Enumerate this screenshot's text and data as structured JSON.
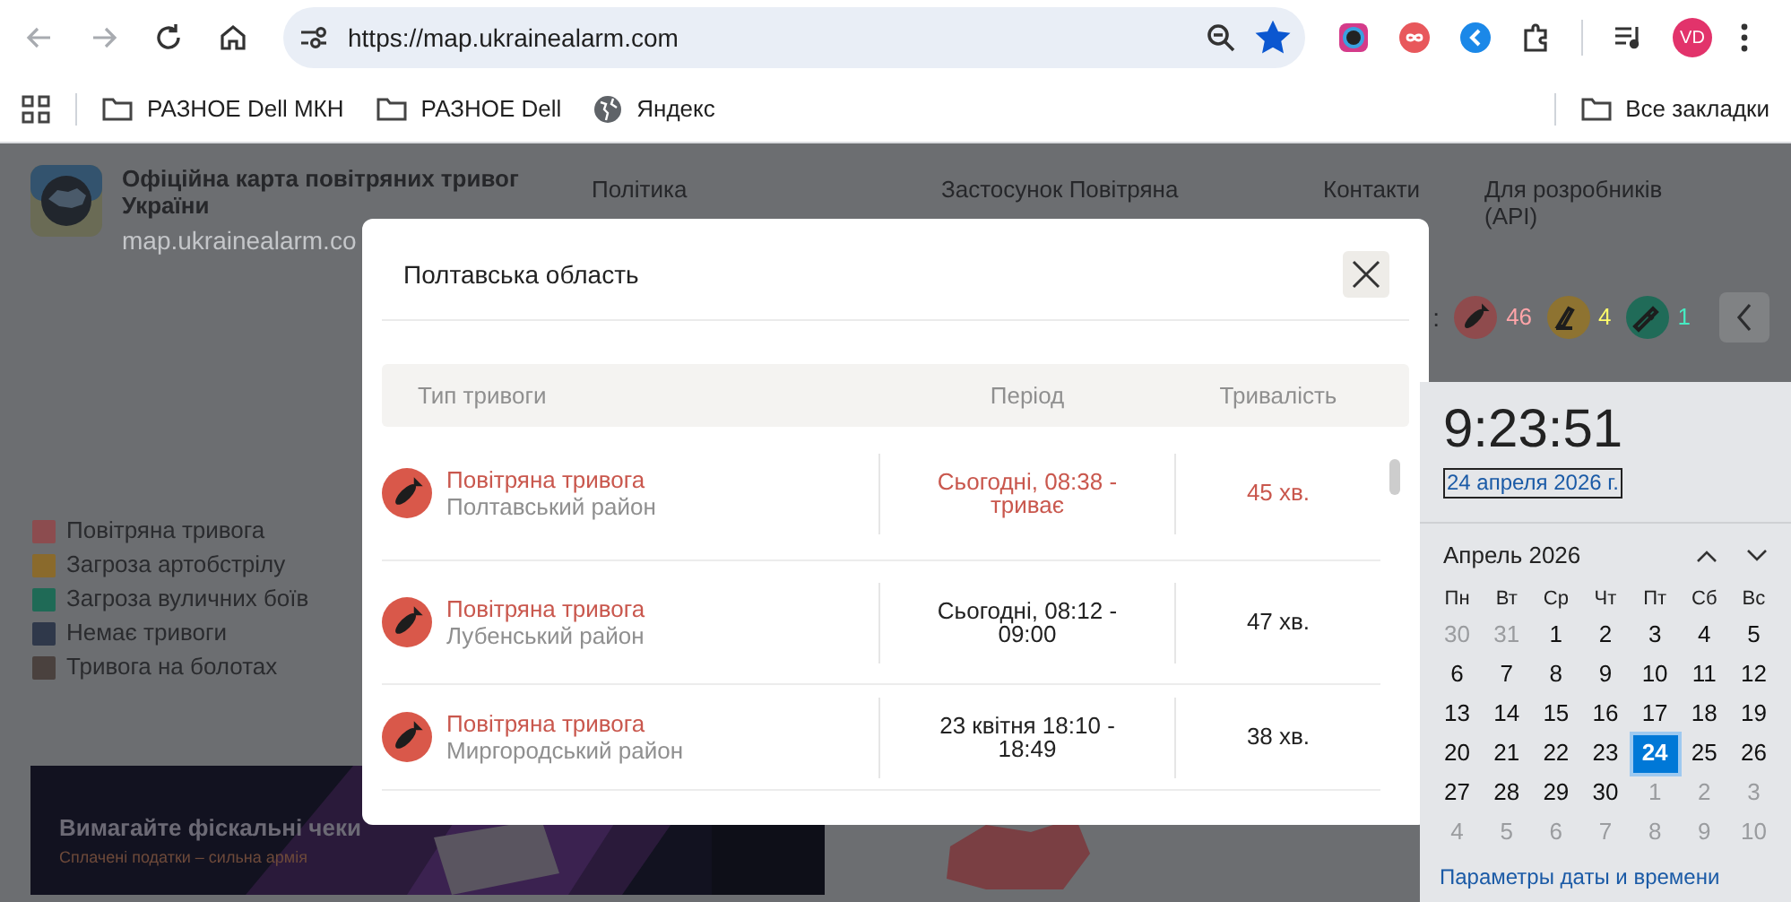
{
  "browser": {
    "nav": [
      {
        "kind": "back",
        "disabled": true
      },
      {
        "kind": "forward",
        "disabled": true
      },
      {
        "kind": "reload",
        "disabled": false
      },
      {
        "kind": "home",
        "disabled": false
      }
    ],
    "url": "https://map.ukrainealarm.com",
    "bookmarked": true,
    "avatar": "VD",
    "bookmarks": [
      {
        "kind": "folder",
        "label": "РАЗНОЕ Dell МКН"
      },
      {
        "kind": "folder",
        "label": "РАЗНОЕ Dell"
      },
      {
        "kind": "site",
        "label": "Яндекс"
      }
    ],
    "all_bookmarks": "Все закладки"
  },
  "page": {
    "title": "Офіційна карта повітряних тривог України",
    "domain": "map.ukrainealarm.co",
    "nav": [
      "Політика",
      "Застосунок Повітряна",
      "Контакти",
      "Для розробників (API)"
    ],
    "counts_label": ":",
    "counts": [
      {
        "kind": "air",
        "value": "46",
        "color": "#8f4b4d"
      },
      {
        "kind": "artillery",
        "value": "4",
        "color": "#8e7331"
      },
      {
        "kind": "street",
        "value": "1",
        "color": "#206b58"
      }
    ],
    "legend": [
      {
        "label": "Повітряна тривога",
        "color": "#8c4c4f"
      },
      {
        "label": "Загроза артобстрілу",
        "color": "#8a6a2c"
      },
      {
        "label": "Загроза вуличних боїв",
        "color": "#1f6a56"
      },
      {
        "label": "Немає тривоги",
        "color": "#2f384a"
      },
      {
        "label": "Тривога на болотах",
        "color": "#4a413e"
      }
    ],
    "banner": {
      "title": "Вимагайте фіскальні чеки",
      "subtitle": "Сплачені податки – сильна армія"
    }
  },
  "modal": {
    "title": "Полтавська область",
    "columns": [
      "Тип тривоги",
      "Період",
      "Тривалість"
    ],
    "rows": [
      {
        "type": "Повітряна тривога",
        "district": "Полтавський район",
        "period": "Сьогодні, 08:38 - триває",
        "duration": "45 хв.",
        "active": true
      },
      {
        "type": "Повітряна тривога",
        "district": "Лубенський район",
        "period": "Сьогодні, 08:12 - 09:00",
        "duration": "47 хв.",
        "active": false
      },
      {
        "type": "Повітряна тривога",
        "district": "Миргородський район",
        "period": "23 квітня 18:10 - 18:49",
        "duration": "38 хв.",
        "active": false
      }
    ]
  },
  "clock": {
    "time": "9:23:51",
    "date": "24 апреля 2026 г.",
    "month": "Апрель 2026",
    "weekdays": [
      "Пн",
      "Вт",
      "Ср",
      "Чт",
      "Пт",
      "Сб",
      "Вс"
    ],
    "days": [
      {
        "label": "30",
        "other_month": true,
        "selected": false
      },
      {
        "label": "31",
        "other_month": true,
        "selected": false
      },
      {
        "label": "1",
        "other_month": false,
        "selected": false
      },
      {
        "label": "2",
        "other_month": false,
        "selected": false
      },
      {
        "label": "3",
        "other_month": false,
        "selected": false
      },
      {
        "label": "4",
        "other_month": false,
        "selected": false
      },
      {
        "label": "5",
        "other_month": false,
        "selected": false
      },
      {
        "label": "6",
        "other_month": false,
        "selected": false
      },
      {
        "label": "7",
        "other_month": false,
        "selected": false
      },
      {
        "label": "8",
        "other_month": false,
        "selected": false
      },
      {
        "label": "9",
        "other_month": false,
        "selected": false
      },
      {
        "label": "10",
        "other_month": false,
        "selected": false
      },
      {
        "label": "11",
        "other_month": false,
        "selected": false
      },
      {
        "label": "12",
        "other_month": false,
        "selected": false
      },
      {
        "label": "13",
        "other_month": false,
        "selected": false
      },
      {
        "label": "14",
        "other_month": false,
        "selected": false
      },
      {
        "label": "15",
        "other_month": false,
        "selected": false
      },
      {
        "label": "16",
        "other_month": false,
        "selected": false
      },
      {
        "label": "17",
        "other_month": false,
        "selected": false
      },
      {
        "label": "18",
        "other_month": false,
        "selected": false
      },
      {
        "label": "19",
        "other_month": false,
        "selected": false
      },
      {
        "label": "20",
        "other_month": false,
        "selected": false
      },
      {
        "label": "21",
        "other_month": false,
        "selected": false
      },
      {
        "label": "22",
        "other_month": false,
        "selected": false
      },
      {
        "label": "23",
        "other_month": false,
        "selected": false
      },
      {
        "label": "24",
        "other_month": false,
        "selected": true
      },
      {
        "label": "25",
        "other_month": false,
        "selected": false
      },
      {
        "label": "26",
        "other_month": false,
        "selected": false
      },
      {
        "label": "27",
        "other_month": false,
        "selected": false
      },
      {
        "label": "28",
        "other_month": false,
        "selected": false
      },
      {
        "label": "29",
        "other_month": false,
        "selected": false
      },
      {
        "label": "30",
        "other_month": false,
        "selected": false
      },
      {
        "label": "1",
        "other_month": true,
        "selected": false
      },
      {
        "label": "2",
        "other_month": true,
        "selected": false
      },
      {
        "label": "3",
        "other_month": true,
        "selected": false
      },
      {
        "label": "4",
        "other_month": true,
        "selected": false
      },
      {
        "label": "5",
        "other_month": true,
        "selected": false
      },
      {
        "label": "6",
        "other_month": true,
        "selected": false
      },
      {
        "label": "7",
        "other_month": true,
        "selected": false
      },
      {
        "label": "8",
        "other_month": true,
        "selected": false
      },
      {
        "label": "9",
        "other_month": true,
        "selected": false
      },
      {
        "label": "10",
        "other_month": true,
        "selected": false
      }
    ],
    "settings_link": "Параметры даты и времени"
  }
}
